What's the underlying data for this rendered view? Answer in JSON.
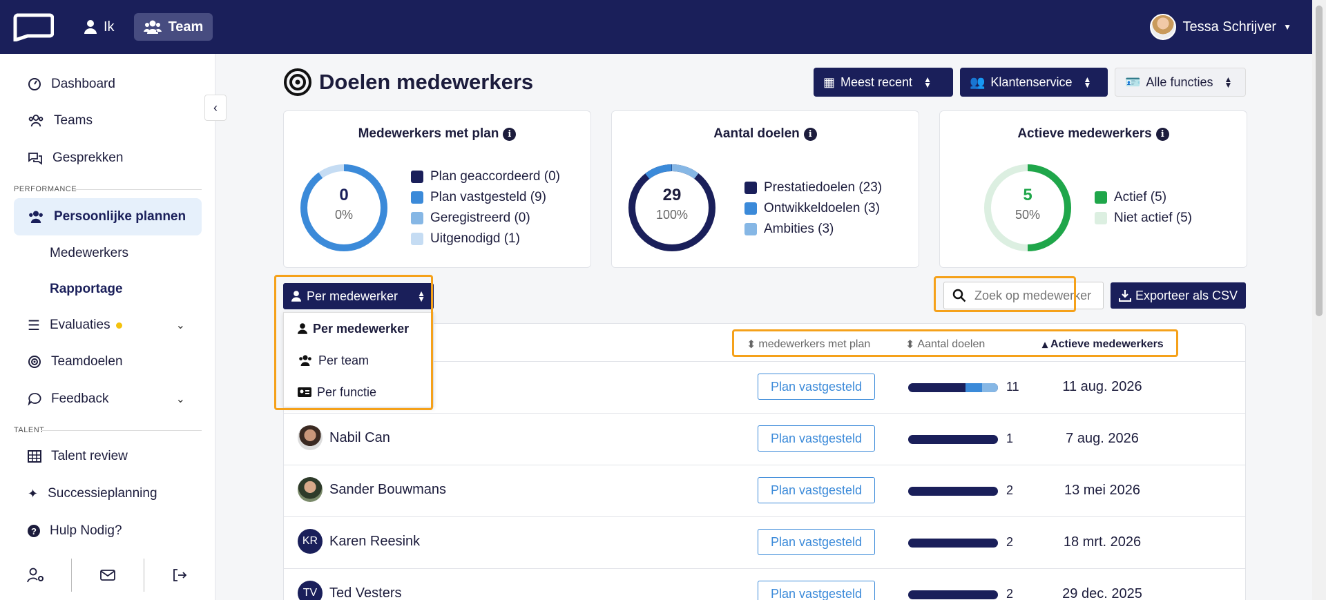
{
  "topbar": {
    "nav": [
      {
        "label": "Ik",
        "icon": "user-icon"
      },
      {
        "label": "Team",
        "icon": "users-icon"
      }
    ],
    "user_name": "Tessa Schrijver"
  },
  "sidebar": {
    "items": [
      {
        "label": "Dashboard",
        "icon": "gauge-icon"
      },
      {
        "label": "Teams",
        "icon": "users-icon"
      },
      {
        "label": "Gesprekken",
        "icon": "chat-icon"
      }
    ],
    "section_performance": "PERFORMANCE",
    "plans": {
      "label": "Persoonlijke plannen",
      "icon": "users-icon"
    },
    "plans_sub": [
      "Medewerkers",
      "Rapportage"
    ],
    "evaluaties": "Evaluaties",
    "teamdoelen": "Teamdoelen",
    "feedback": "Feedback",
    "section_talent": "TALENT",
    "talent": [
      "Talent review",
      "Successieplanning",
      "Hulp Nodig?"
    ]
  },
  "page": {
    "title": "Doelen medewerkers",
    "filters": [
      "Meest recent",
      "Klantenservice",
      "Alle functies"
    ]
  },
  "cards": [
    {
      "title": "Medewerkers met plan",
      "value": "0",
      "pct": "0%",
      "legend": [
        {
          "label": "Plan geaccordeerd (0)",
          "color": "#1a1f5a"
        },
        {
          "label": "Plan vastgesteld (9)",
          "color": "#3b8ad9"
        },
        {
          "label": "Geregistreerd (0)",
          "color": "#86b7e5"
        },
        {
          "label": "Uitgenodigd (1)",
          "color": "#c5dcf3"
        }
      ]
    },
    {
      "title": "Aantal doelen",
      "value": "29",
      "pct": "100%",
      "legend": [
        {
          "label": "Prestatiedoelen (23)",
          "color": "#1a1f5a"
        },
        {
          "label": "Ontwikkeldoelen (3)",
          "color": "#3b8ad9"
        },
        {
          "label": "Ambities (3)",
          "color": "#86b7e5"
        }
      ]
    },
    {
      "title": "Actieve medewerkers",
      "value": "5",
      "pct": "50%",
      "legend": [
        {
          "label": "Actief (5)",
          "color": "#1fa64a"
        },
        {
          "label": "Niet actief (5)",
          "color": "#dcefe1"
        }
      ]
    }
  ],
  "toolbar": {
    "group_by": "Per medewerker",
    "options": [
      "Per medewerker",
      "Per team",
      "Per functie"
    ],
    "search_placeholder": "Zoek op medewerker",
    "export_label": "Exporteer als CSV"
  },
  "table": {
    "headers": [
      "medewerkers met plan",
      "Aantal doelen",
      "Actieve medewerkers"
    ],
    "rows": [
      {
        "name": "",
        "avatar": "",
        "status": "Plan vastgesteld",
        "goals": "11",
        "date": "11 aug. 2026",
        "mix": [
          0.64,
          0.18,
          0.18
        ]
      },
      {
        "name": "Nabil Can",
        "avatar": "photo",
        "status": "Plan vastgesteld",
        "goals": "1",
        "date": "7 aug. 2026",
        "mix": [
          1,
          0,
          0
        ]
      },
      {
        "name": "Sander Bouwmans",
        "avatar": "photo",
        "status": "Plan vastgesteld",
        "goals": "2",
        "date": "13 mei 2026",
        "mix": [
          1,
          0,
          0
        ]
      },
      {
        "name": "Karen Reesink",
        "avatar": "KR",
        "status": "Plan vastgesteld",
        "goals": "2",
        "date": "18 mrt. 2026",
        "mix": [
          1,
          0,
          0
        ]
      },
      {
        "name": "Ted Vesters",
        "avatar": "TV",
        "status": "Plan vastgesteld",
        "goals": "2",
        "date": "29 dec. 2025",
        "mix": [
          1,
          0,
          0
        ]
      }
    ]
  }
}
